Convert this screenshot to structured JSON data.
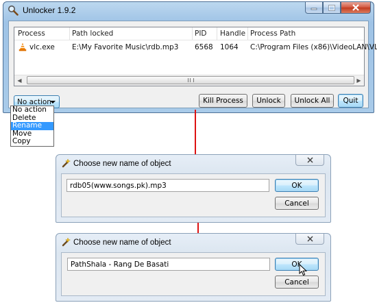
{
  "main_window": {
    "title": "Unlocker 1.9.2",
    "columns": [
      "Process",
      "Path locked",
      "PID",
      "Handle",
      "Process Path"
    ],
    "rows": [
      {
        "process": "vlc.exe",
        "path_locked": "E:\\My Favorite Music\\rdb.mp3",
        "pid": "6568",
        "handle": "1064",
        "process_path": "C:\\Program Files (x86)\\VideoLAN\\VL..."
      }
    ],
    "action_combo": {
      "selected": "No action"
    },
    "action_options": [
      "No action",
      "Delete",
      "Rename",
      "Move",
      "Copy"
    ],
    "highlighted_option": "Rename",
    "buttons": {
      "kill_process": "Kill Process",
      "unlock": "Unlock",
      "unlock_all": "Unlock All",
      "quit": "Quit"
    }
  },
  "dialogs": [
    {
      "title": "Choose new name of object",
      "value": "rdb05(www.songs.pk).mp3",
      "ok": "OK",
      "cancel": "Cancel"
    },
    {
      "title": "Choose new name of object",
      "value": "PathShala - Rang De Basati",
      "ok": "OK",
      "cancel": "Cancel"
    }
  ],
  "colors": {
    "arrow": "#dd1111",
    "selection": "#3399ff",
    "title_bar": "#a9cbe9"
  },
  "icons": [
    "magnifier-icon",
    "vlc-cone-icon",
    "minimize-icon",
    "maximize-icon",
    "close-icon",
    "wand-icon",
    "mouse-cursor-icon"
  ]
}
